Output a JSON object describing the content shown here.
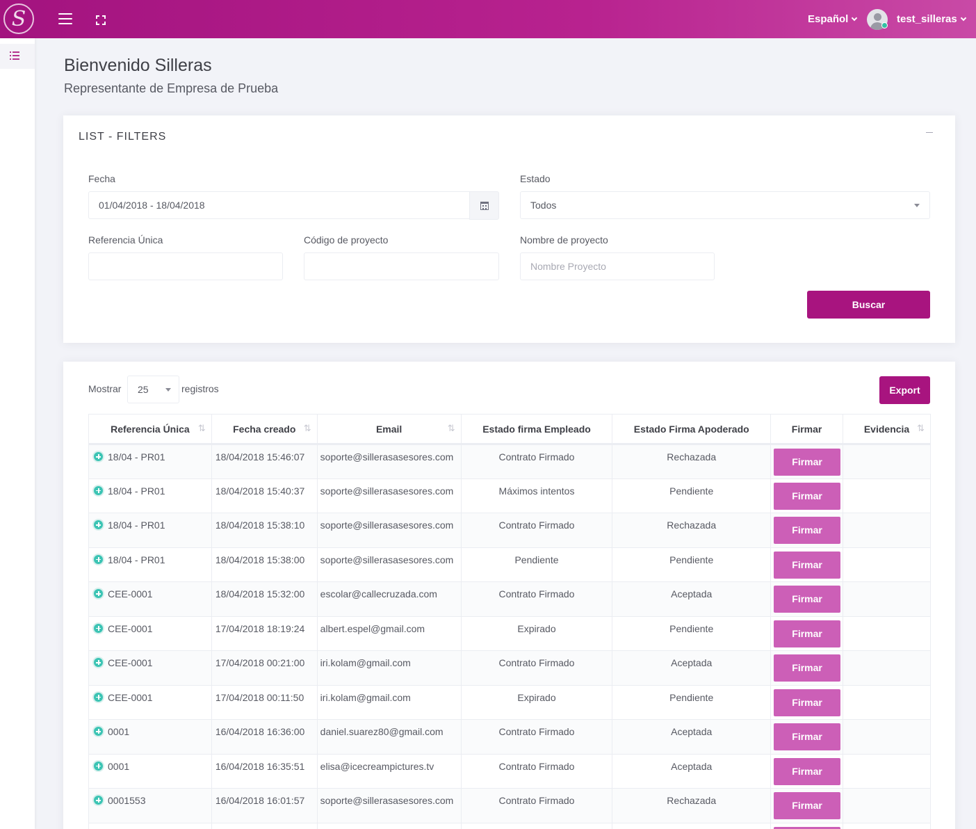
{
  "topbar": {
    "logo_letter": "S",
    "language": "Español",
    "username": "test_silleras",
    "colors": {
      "brand": "#a3137f",
      "accent": "#cc5fb7",
      "online": "#34bfa3"
    }
  },
  "header": {
    "welcome": "Bienvenido Silleras",
    "subtitle": "Representante de Empresa de Prueba"
  },
  "filters": {
    "title": "LIST - FILTERS",
    "fecha_label": "Fecha",
    "fecha_value": "01/04/2018 - 18/04/2018",
    "estado_label": "Estado",
    "estado_value": "Todos",
    "referencia_label": "Referencia Única",
    "referencia_value": "",
    "codigo_label": "Código de proyecto",
    "codigo_value": "",
    "nombre_label": "Nombre de proyecto",
    "nombre_placeholder": "Nombre Proyecto",
    "search_button": "Buscar"
  },
  "list": {
    "show_label": "Mostrar",
    "page_size": "25",
    "records_label": "registros",
    "export_button": "Export",
    "columns": [
      "Referencia Única",
      "Fecha creado",
      "Email",
      "Estado firma Empleado",
      "Estado Firma Apoderado",
      "Firmar",
      "Evidencia"
    ],
    "sign_label": "Firmar",
    "rows": [
      {
        "ref": "18/04 - PR01",
        "date": "18/04/2018 15:46:07",
        "email": "soporte@sillerasasesores.com",
        "empleado": "Contrato Firmado",
        "apoderado": "Rechazada"
      },
      {
        "ref": "18/04 - PR01",
        "date": "18/04/2018 15:40:37",
        "email": "soporte@sillerasasesores.com",
        "empleado": "Máximos intentos",
        "apoderado": "Pendiente"
      },
      {
        "ref": "18/04 - PR01",
        "date": "18/04/2018 15:38:10",
        "email": "soporte@sillerasasesores.com",
        "empleado": "Contrato Firmado",
        "apoderado": "Rechazada"
      },
      {
        "ref": "18/04 - PR01",
        "date": "18/04/2018 15:38:00",
        "email": "soporte@sillerasasesores.com",
        "empleado": "Pendiente",
        "apoderado": "Pendiente"
      },
      {
        "ref": "CEE-0001",
        "date": "18/04/2018 15:32:00",
        "email": "escolar@callecruzada.com",
        "empleado": "Contrato Firmado",
        "apoderado": "Aceptada"
      },
      {
        "ref": "CEE-0001",
        "date": "17/04/2018 18:19:24",
        "email": "albert.espel@gmail.com",
        "empleado": "Expirado",
        "apoderado": "Pendiente"
      },
      {
        "ref": "CEE-0001",
        "date": "17/04/2018 00:21:00",
        "email": "iri.kolam@gmail.com",
        "empleado": "Contrato Firmado",
        "apoderado": "Aceptada"
      },
      {
        "ref": "CEE-0001",
        "date": "17/04/2018 00:11:50",
        "email": "iri.kolam@gmail.com",
        "empleado": "Expirado",
        "apoderado": "Pendiente"
      },
      {
        "ref": "0001",
        "date": "16/04/2018 16:36:00",
        "email": "daniel.suarez80@gmail.com",
        "empleado": "Contrato Firmado",
        "apoderado": "Aceptada"
      },
      {
        "ref": "0001",
        "date": "16/04/2018 16:35:51",
        "email": "elisa@icecreampictures.tv",
        "empleado": "Contrato Firmado",
        "apoderado": "Aceptada"
      },
      {
        "ref": "0001553",
        "date": "16/04/2018 16:01:57",
        "email": "soporte@sillerasasesores.com",
        "empleado": "Contrato Firmado",
        "apoderado": "Rechazada"
      },
      {
        "ref": "",
        "date": "",
        "email": "",
        "empleado": "",
        "apoderado": ""
      }
    ]
  }
}
